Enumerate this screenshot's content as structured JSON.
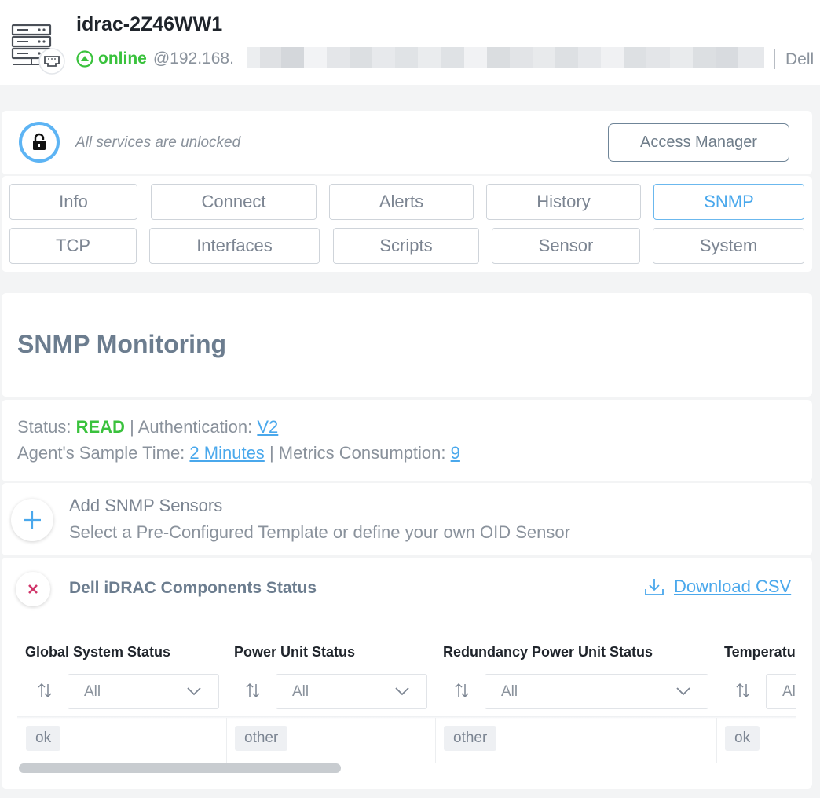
{
  "header": {
    "device_name": "idrac-2Z46WW1",
    "status": "online",
    "ip_prefix": "@192.168.",
    "vendor": "Dell",
    "icon": "server-rack-icon",
    "status_icon": "online-up-arrow-icon",
    "status_color": "#3ac23d"
  },
  "lock": {
    "icon": "unlocked-padlock-icon",
    "text": "All services are unlocked",
    "button_label": "Access Manager"
  },
  "tabs": [
    {
      "label": "Info",
      "active": false
    },
    {
      "label": "Connect",
      "active": false
    },
    {
      "label": "Alerts",
      "active": false
    },
    {
      "label": "History",
      "active": false
    },
    {
      "label": "SNMP",
      "active": true
    },
    {
      "label": "TCP",
      "active": false
    },
    {
      "label": "Interfaces",
      "active": false
    },
    {
      "label": "Scripts",
      "active": false
    },
    {
      "label": "Sensor",
      "active": false
    },
    {
      "label": "System",
      "active": false
    }
  ],
  "page": {
    "title": "SNMP Monitoring"
  },
  "snmp_status": {
    "status_label": "Status:",
    "status_value": "READ",
    "auth_label": "Authentication:",
    "auth_value": "V2",
    "sample_label": "Agent's Sample Time:",
    "sample_value": "2 Minutes",
    "metrics_label": "Metrics Consumption:",
    "metrics_value": "9",
    "separator": "|"
  },
  "add_sensors": {
    "icon": "plus-icon",
    "title": "Add SNMP Sensors",
    "subtitle": "Select a Pre-Configured Template or define your own OID Sensor"
  },
  "components_table": {
    "close_icon": "close-x-icon",
    "title": "Dell iDRAC Components Status",
    "download_icon": "download-icon",
    "download_label": "Download CSV",
    "columns": [
      {
        "header": "Global System Status",
        "filter": "All",
        "value": "ok"
      },
      {
        "header": "Power Unit Status",
        "filter": "All",
        "value": "other"
      },
      {
        "header": "Redundancy Power Unit Status",
        "filter": "All",
        "value": "other"
      },
      {
        "header": "Temperatu",
        "filter": "Al",
        "value": "ok"
      }
    ]
  },
  "colors": {
    "accent_blue": "#4aa8ec",
    "green": "#3ac23d",
    "close_red": "#d0366a"
  }
}
